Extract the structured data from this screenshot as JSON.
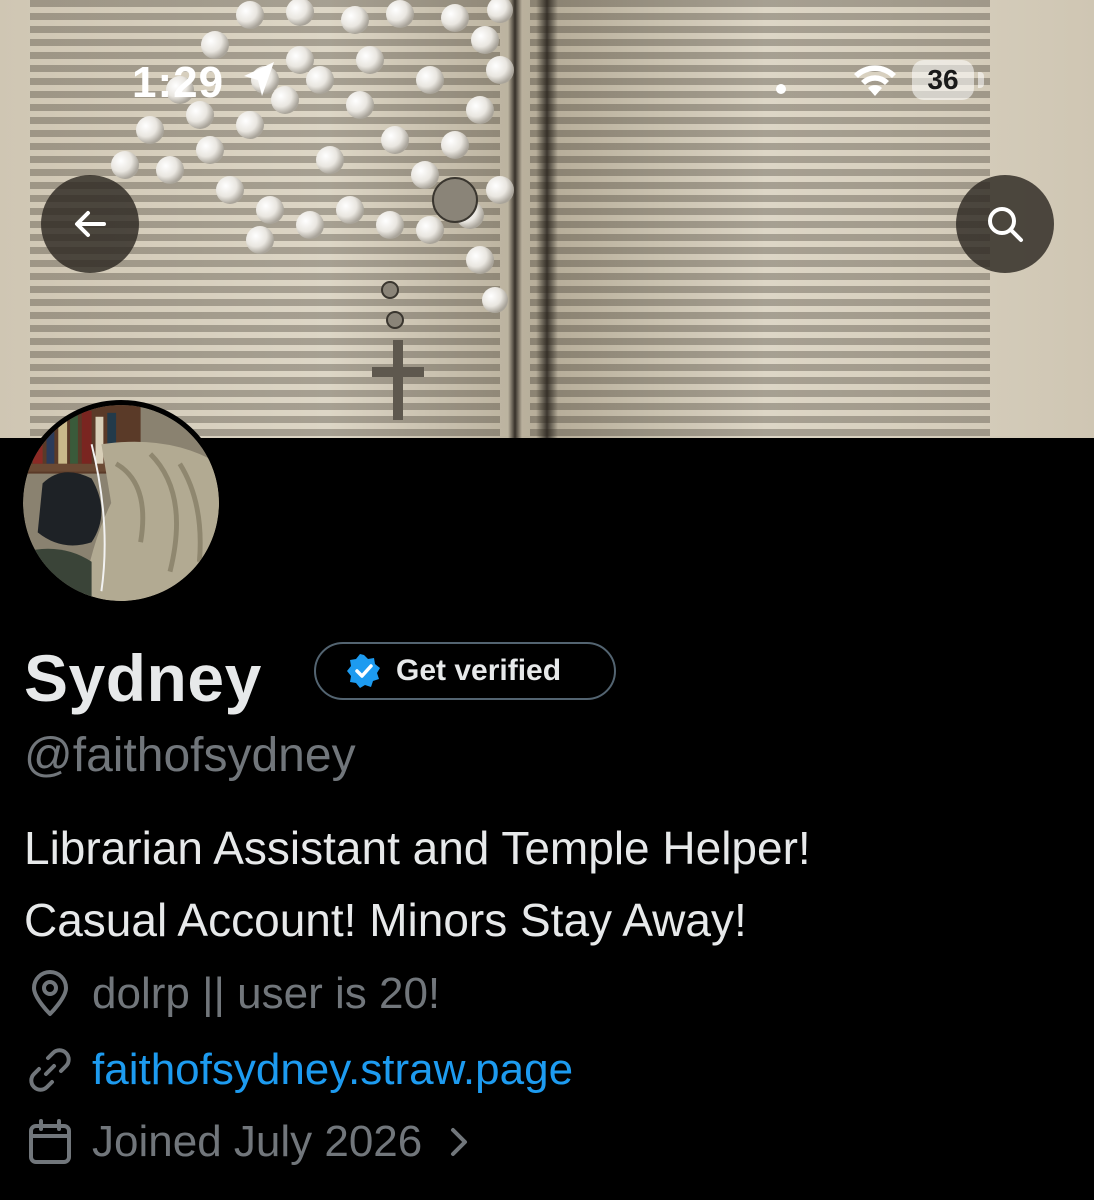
{
  "status_bar": {
    "time": "1:29",
    "battery": "36",
    "icons": [
      "location-arrow-icon",
      "wifi-icon",
      "battery-icon"
    ]
  },
  "header": {
    "back_icon": "arrow-left-icon",
    "search_icon": "search-icon"
  },
  "profile": {
    "display_name": "Sydney",
    "verify_button_label": "Get verified",
    "handle": "@faithofsydney",
    "bio": "Librarian Assistant and Temple Helper!\nCasual Account! Minors Stay Away!",
    "location": "dolrp || user is 20!",
    "website": "faithofsydney.straw.page",
    "joined": "Joined July 2026"
  },
  "colors": {
    "background": "#000000",
    "primary_text": "#e7e9ea",
    "secondary_text": "#71767b",
    "link": "#1d9bf0",
    "verified_badge": "#1d9bf0",
    "button_border": "#536471"
  }
}
